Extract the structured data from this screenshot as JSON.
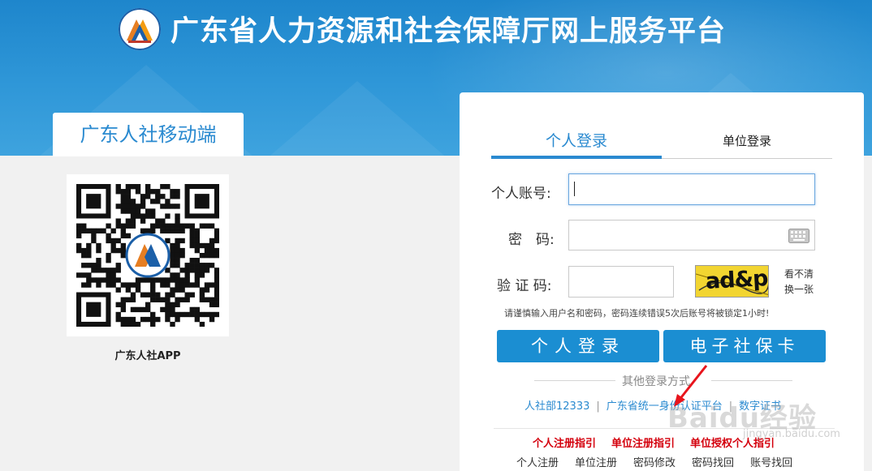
{
  "header": {
    "title": "广东省人力资源和社会保障厅网上服务平台",
    "background_color": "#2a90d4"
  },
  "mobile": {
    "tab_label": "广东人社移动端",
    "app_label": "广东人社APP"
  },
  "login": {
    "tabs": [
      "个人登录",
      "单位登录"
    ],
    "active_tab": "个人登录",
    "account_label": "个人账号:",
    "account_value": "",
    "password_label": "密　码:",
    "password_value": "",
    "captcha_label": "验 证 码:",
    "captcha_value": "",
    "captcha_text": "ad&p",
    "refresh_line1": "看不清",
    "refresh_line2": "换一张",
    "hint": "请谨慎输入用户名和密码，密码连续错误5次后账号将被锁定1小时!",
    "login_button": "个人登录",
    "card_button": "电子社保卡",
    "other_title": "其他登录方式",
    "alt_links": [
      "人社部12333",
      "广东省统一身份认证平台",
      "数字证书"
    ],
    "guides": [
      "个人注册指引",
      "单位注册指引",
      "单位授权个人指引"
    ],
    "bottom_links": [
      "个人注册",
      "单位注册",
      "密码修改",
      "密码找回",
      "账号找回"
    ],
    "accent_color": "#2a8ad0",
    "button_color": "#1b8ed2",
    "guide_color": "#d4000d"
  },
  "watermark": {
    "text": "Baidu经验",
    "sub": "jingyan.baidu.com"
  }
}
